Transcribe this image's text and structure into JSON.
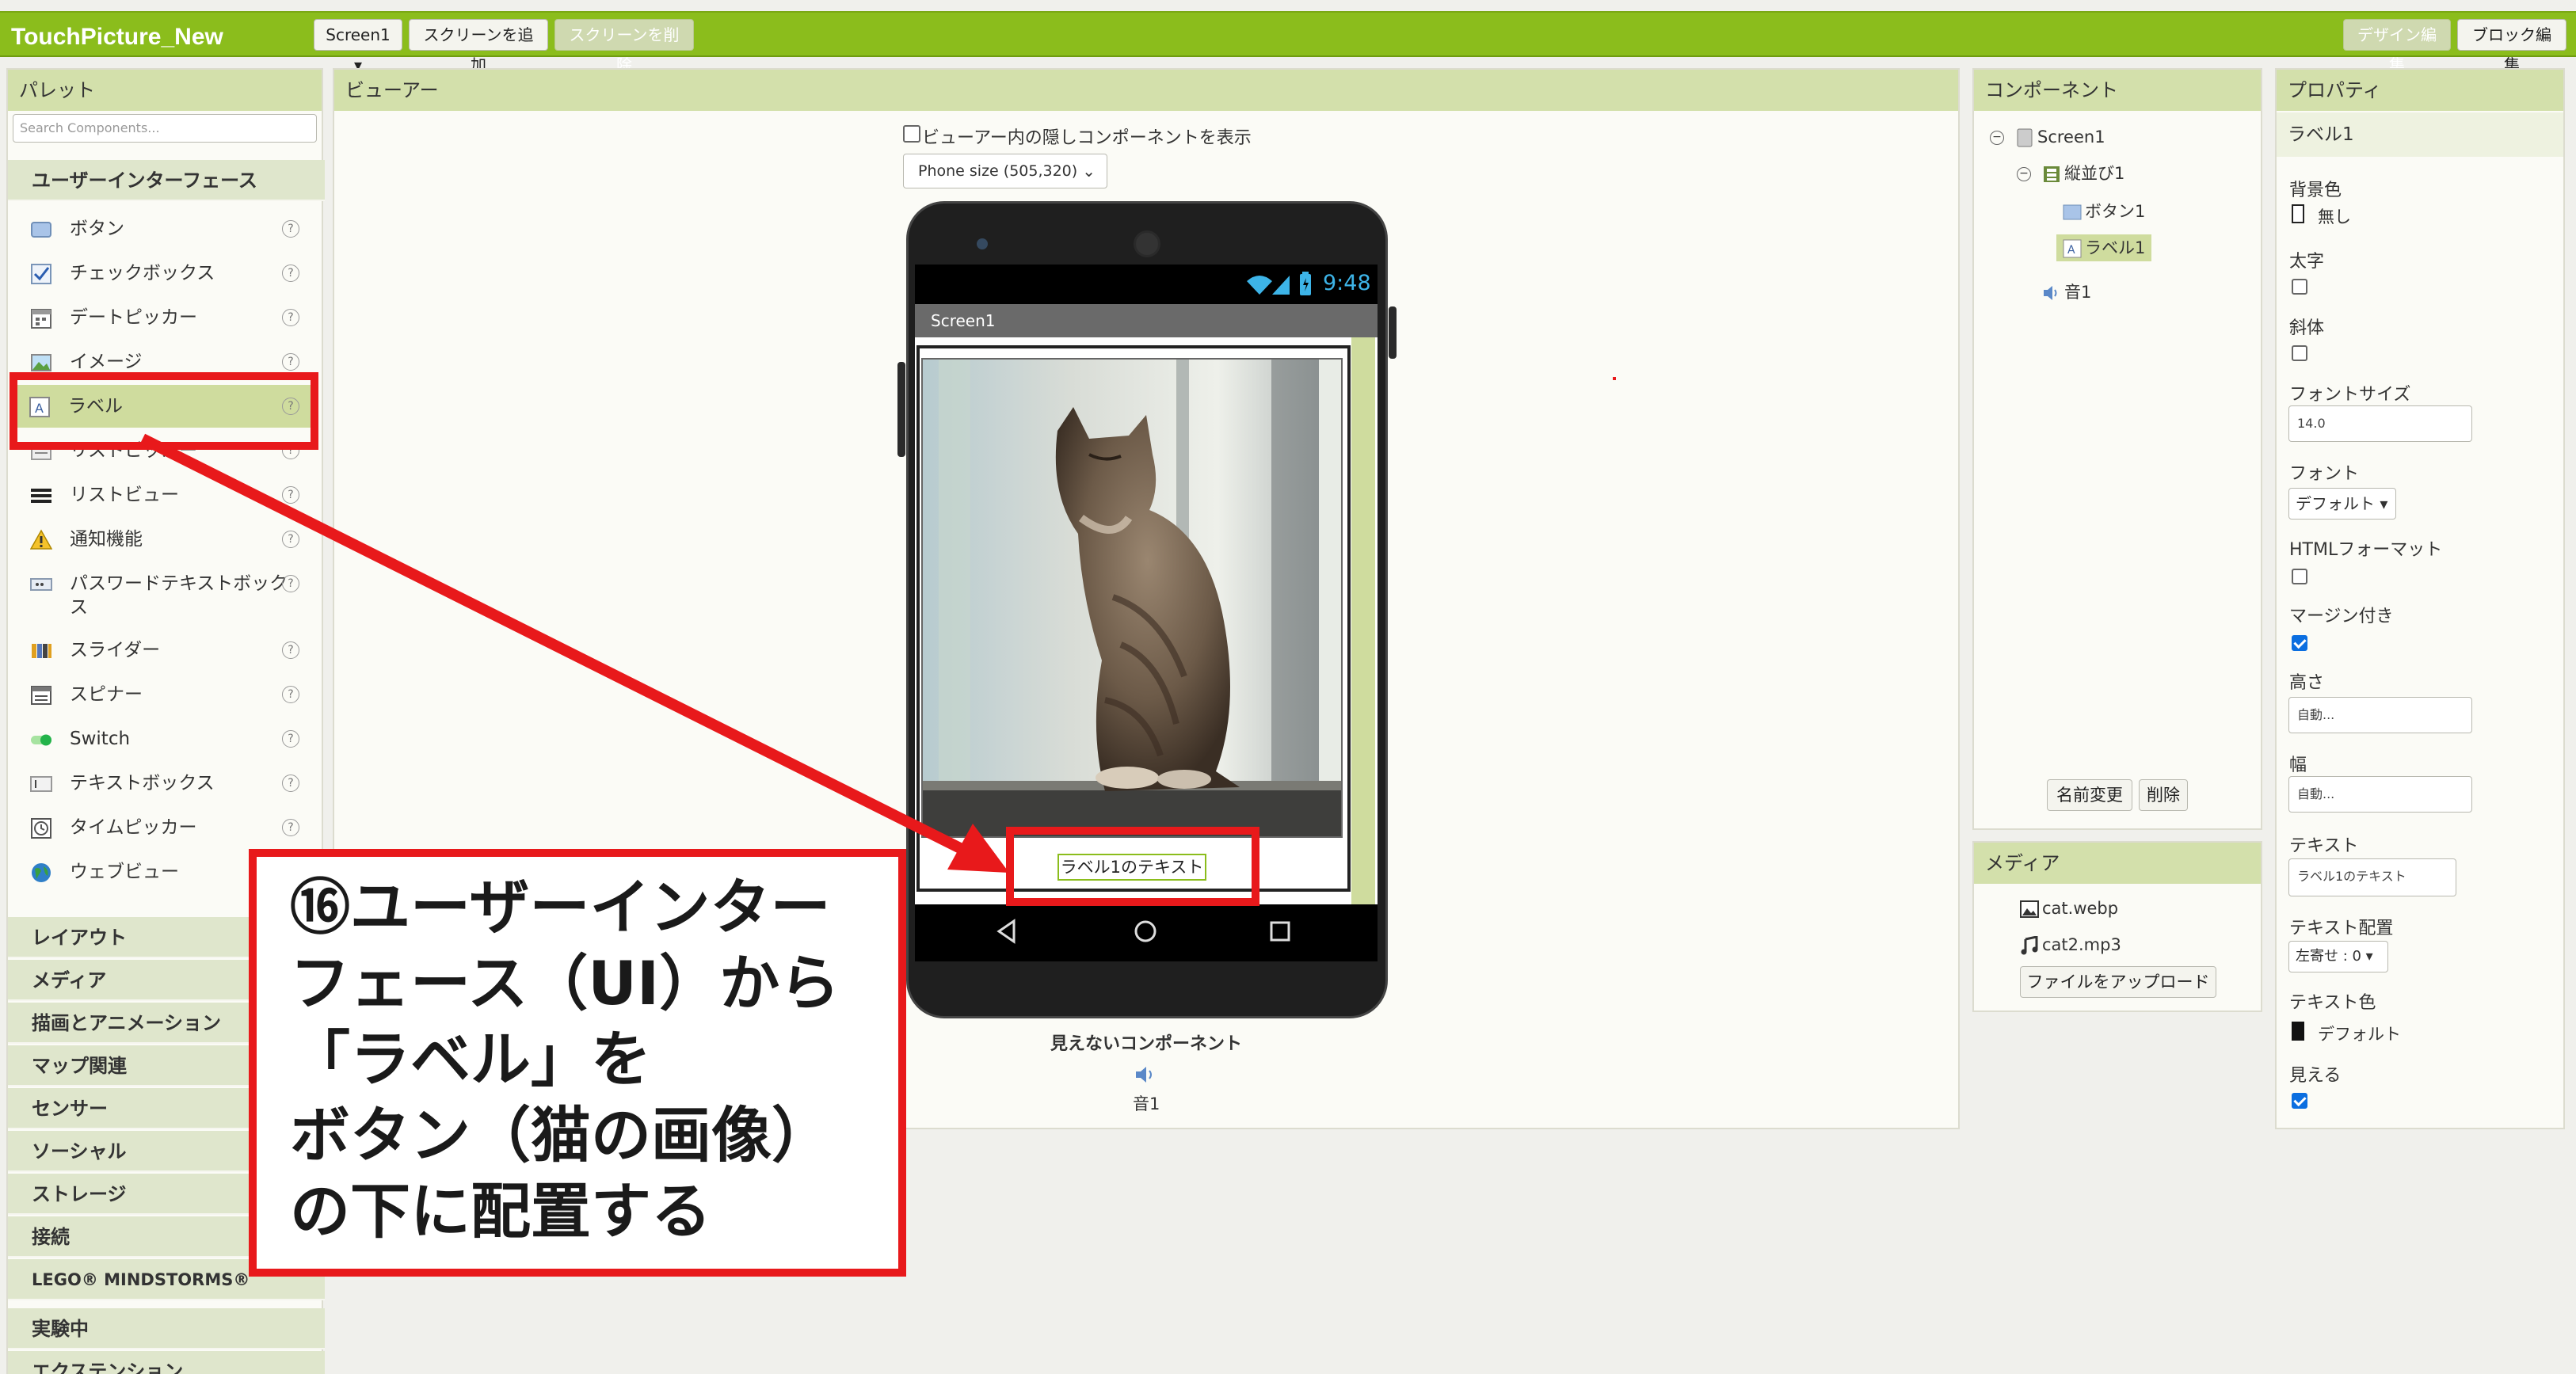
{
  "app": {
    "title": "TouchPicture_New"
  },
  "toolbar": {
    "screen_select": "Screen1 ▾",
    "add_screen": "スクリーンを追加",
    "remove_screen": "スクリーンを削除",
    "designer": "デザイン編集",
    "blocks": "ブロック編集"
  },
  "palette": {
    "title": "パレット",
    "search_placeholder": "Search Components...",
    "category_ui": "ユーザーインターフェース",
    "items": [
      {
        "label": "ボタン",
        "icon": "button-icon"
      },
      {
        "label": "チェックボックス",
        "icon": "checkbox-icon"
      },
      {
        "label": "デートピッカー",
        "icon": "calendar-icon"
      },
      {
        "label": "イメージ",
        "icon": "image-icon"
      },
      {
        "label": "ラベル",
        "icon": "label-icon"
      },
      {
        "label": "リストピッカー",
        "icon": "list-picker-icon"
      },
      {
        "label": "リストビュー",
        "icon": "list-view-icon"
      },
      {
        "label": "通知機能",
        "icon": "warning-icon"
      },
      {
        "label": "パスワードテキストボックス",
        "icon": "password-icon"
      },
      {
        "label": "スライダー",
        "icon": "slider-icon"
      },
      {
        "label": "スピナー",
        "icon": "spinner-icon"
      },
      {
        "label": "Switch",
        "icon": "switch-icon"
      },
      {
        "label": "テキストボックス",
        "icon": "textbox-icon"
      },
      {
        "label": "タイムピッカー",
        "icon": "clock-icon"
      },
      {
        "label": "ウェブビュー",
        "icon": "globe-icon"
      }
    ],
    "categories": [
      "レイアウト",
      "メディア",
      "描画とアニメーション",
      "マップ関連",
      "センサー",
      "ソーシャル",
      "ストレージ",
      "接続",
      "LEGO® MINDSTORMS®",
      "実験中",
      "エクステンション"
    ]
  },
  "viewer": {
    "title": "ビューアー",
    "hidden_checkbox_label": "ビューアー内の隠しコンポーネントを表示",
    "size_select": "Phone size (505,320)",
    "status_time": "9:48",
    "screen_title": "Screen1",
    "label_text": "ラベル1のテキスト",
    "nonvisible_title": "見えないコンポーネント",
    "nonvisible_item": "音1"
  },
  "components": {
    "title": "コンポーネント",
    "tree": [
      "Screen1",
      "縦並び1",
      "ボタン1",
      "ラベル1",
      "音1"
    ],
    "rename": "名前変更",
    "delete": "削除"
  },
  "media": {
    "title": "メディア",
    "files": [
      "cat.webp",
      "cat2.mp3"
    ],
    "upload": "ファイルをアップロード"
  },
  "properties": {
    "title": "プロパティ",
    "component": "ラベル1",
    "bg_color_label": "背景色",
    "bg_color_value": "無し",
    "bold_label": "太字",
    "italic_label": "斜体",
    "font_size_label": "フォントサイズ",
    "font_size_value": "14.0",
    "font_label": "フォント",
    "font_value": "デフォルト ▾",
    "html_label": "HTMLフォーマット",
    "margin_label": "マージン付き",
    "height_label": "高さ",
    "height_value": "自動...",
    "width_label": "幅",
    "width_value": "自動...",
    "text_label": "テキスト",
    "text_value": "ラベル1のテキスト",
    "align_label": "テキスト配置",
    "align_value": "左寄せ : 0 ▾",
    "text_color_label": "テキスト色",
    "text_color_value": "デフォルト",
    "visible_label": "見える"
  },
  "annotation": {
    "text": "⑯ユーザーインター\nフェース（UI）から\n「ラベル」を\nボタン（猫の画像）\nの下に配置する"
  },
  "colors": {
    "accent": "#8bbd1c",
    "annotation_red": "#e8191b",
    "selected": "#cfdc9e"
  }
}
